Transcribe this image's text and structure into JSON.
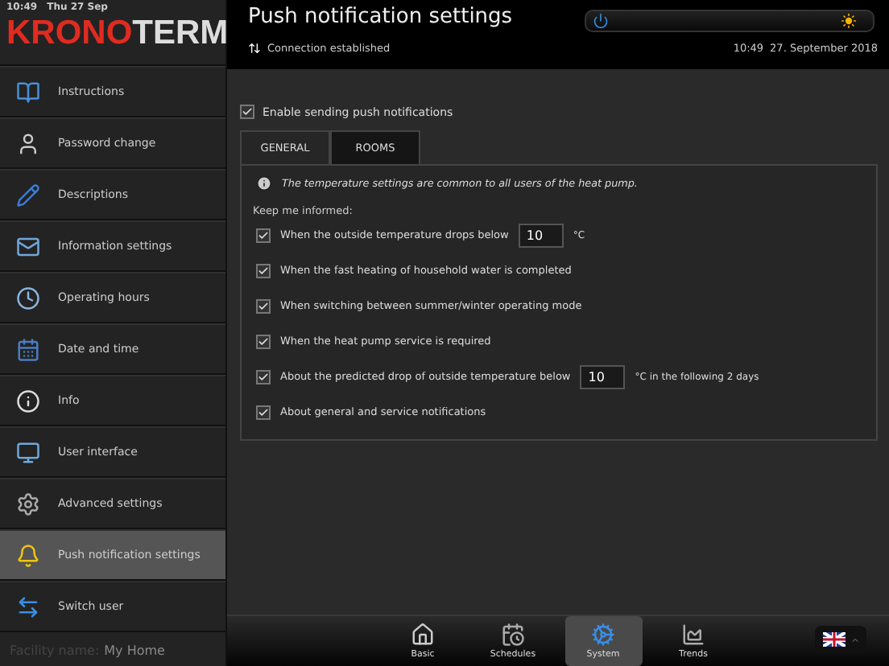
{
  "status_bar": {
    "time": "10:49",
    "date": "Thu 27 Sep"
  },
  "logo": {
    "part_1": "KRONO",
    "part_2": "TERM"
  },
  "sidebar": {
    "items": [
      {
        "label": "Instructions",
        "selected": false
      },
      {
        "label": "Password change",
        "selected": false
      },
      {
        "label": "Descriptions",
        "selected": false
      },
      {
        "label": "Information settings",
        "selected": false
      },
      {
        "label": "Operating hours",
        "selected": false
      },
      {
        "label": "Date and time",
        "selected": false
      },
      {
        "label": "Info",
        "selected": false
      },
      {
        "label": "User interface",
        "selected": false
      },
      {
        "label": "Advanced settings",
        "selected": false
      },
      {
        "label": "Push notification settings",
        "selected": true
      },
      {
        "label": "Switch user",
        "selected": false
      }
    ],
    "facility_label": "Facility name:",
    "facility_name": "My Home"
  },
  "header": {
    "title": "Push notification settings",
    "connection": "Connection established",
    "time": "10:49",
    "date": "27. September 2018"
  },
  "enable": {
    "label": "Enable sending push notifications",
    "checked": true
  },
  "tabs": [
    {
      "label": "GENERAL",
      "selected": true
    },
    {
      "label": "ROOMS",
      "selected": false
    }
  ],
  "panel": {
    "info": "The temperature settings are common to all users of the heat pump.",
    "heading": "Keep me informed:",
    "options": [
      {
        "kind": "input",
        "label": "When the outside temperature drops below",
        "value": "10",
        "suffix": "°C",
        "checked": true
      },
      {
        "kind": "plain",
        "label": "When the fast heating of household water is completed",
        "checked": true
      },
      {
        "kind": "plain",
        "label": "When switching between summer/winter operating mode",
        "checked": true
      },
      {
        "kind": "plain",
        "label": "When the heat pump service is required",
        "checked": true
      },
      {
        "kind": "input",
        "label": "About the predicted drop of outside temperature below",
        "value": "10",
        "suffix": "°C in the following 2 days",
        "checked": true
      },
      {
        "kind": "plain",
        "label": "About general and service notifications",
        "checked": true
      }
    ]
  },
  "bottom_nav": [
    {
      "label": "Basic",
      "selected": false
    },
    {
      "label": "Schedules",
      "selected": false
    },
    {
      "label": "System",
      "selected": true
    },
    {
      "label": "Trends",
      "selected": false
    }
  ]
}
